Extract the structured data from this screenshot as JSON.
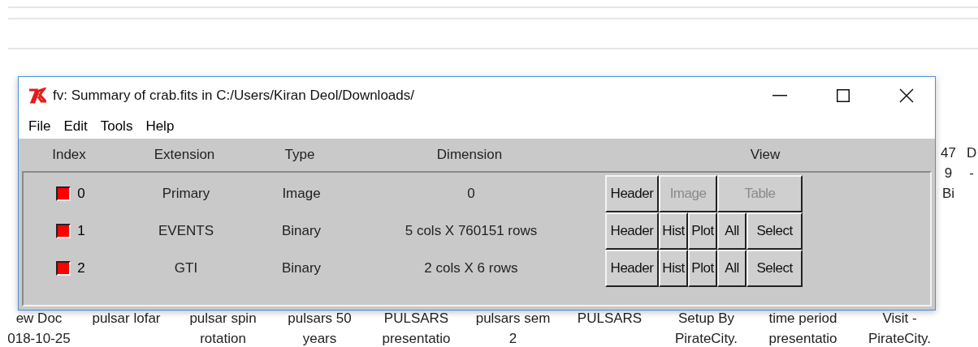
{
  "window": {
    "title": "fv: Summary of crab.fits in C:/Users/Kiran Deol/Downloads/"
  },
  "menu": [
    "File",
    "Edit",
    "Tools",
    "Help"
  ],
  "columns": [
    "Index",
    "Extension",
    "Type",
    "Dimension",
    "View"
  ],
  "rows": [
    {
      "index": "0",
      "marked": true,
      "extension": "Primary",
      "type": "Image",
      "dimension": "0",
      "buttons": [
        {
          "label": "Header",
          "kind": "single",
          "disabled": false
        },
        {
          "label": "Image",
          "kind": "double",
          "disabled": true
        },
        {
          "label": "Table",
          "kind": "double",
          "disabled": true
        }
      ]
    },
    {
      "index": "1",
      "marked": true,
      "extension": "EVENTS",
      "type": "Binary",
      "dimension": "5 cols X 760151 rows",
      "buttons": [
        {
          "label": "Header",
          "kind": "single",
          "disabled": false
        },
        {
          "label": "Hist",
          "kind": "single",
          "disabled": false
        },
        {
          "label": "Plot",
          "kind": "single",
          "disabled": false
        },
        {
          "label": "All",
          "kind": "single",
          "disabled": false
        },
        {
          "label": "Select",
          "kind": "single",
          "disabled": false
        }
      ]
    },
    {
      "index": "2",
      "marked": true,
      "extension": "GTI",
      "type": "Binary",
      "dimension": "2 cols X 6 rows",
      "buttons": [
        {
          "label": "Header",
          "kind": "single",
          "disabled": false
        },
        {
          "label": "Hist",
          "kind": "single",
          "disabled": false
        },
        {
          "label": "Plot",
          "kind": "single",
          "disabled": false
        },
        {
          "label": "All",
          "kind": "single",
          "disabled": false
        },
        {
          "label": "Select",
          "kind": "single",
          "disabled": false
        }
      ]
    }
  ],
  "desktop_icons": [
    {
      "lines": [
        "ew Doc",
        "018-10-25"
      ]
    },
    {
      "lines": [
        "pulsar lofar"
      ]
    },
    {
      "lines": [
        "pulsar spin",
        "rotation"
      ]
    },
    {
      "lines": [
        "pulsars 50",
        "years"
      ]
    },
    {
      "lines": [
        "PULSARS",
        "presentatio"
      ]
    },
    {
      "lines": [
        "pulsars sem",
        "2"
      ]
    },
    {
      "lines": [
        "PULSARS"
      ]
    },
    {
      "lines": [
        "Setup By",
        "PirateCity."
      ]
    },
    {
      "lines": [
        "time period",
        "presentatio"
      ]
    },
    {
      "lines": [
        "Visit -",
        "PirateCity."
      ]
    }
  ],
  "right_fragments": [
    {
      "lines": [
        "47",
        "9",
        "Bi"
      ]
    },
    {
      "lines": [
        "D",
        "-"
      ]
    }
  ]
}
